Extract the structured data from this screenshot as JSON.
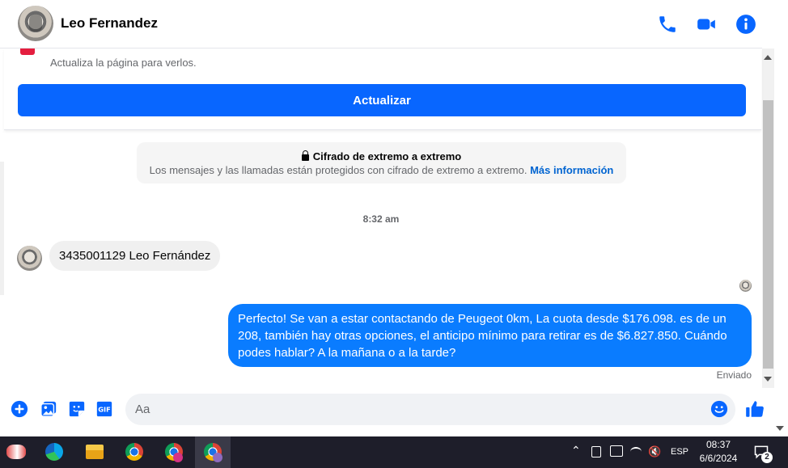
{
  "header": {
    "contact_name": "Leo Fernandez"
  },
  "banner": {
    "message": "Actualiza la página para verlos.",
    "refresh_label": "Actualizar"
  },
  "encryption": {
    "title": "Cifrado de extremo a extremo",
    "body": "Los mensajes y las llamadas están protegidos con cifrado de extremo a extremo.",
    "link": "Más información"
  },
  "conversation": {
    "timestamp": "8:32 am",
    "incoming": "3435001129 Leo Fernández",
    "outgoing": "Perfecto!  Se van a estar contactando de Peugeot 0km, La cuota desde $176.098. es de un 208, también hay otras opciones, el anticipo mínimo para retirar es de $6.827.850. Cuándo podes hablar? A la mañana o a la tarde?",
    "status": "Enviado"
  },
  "composer": {
    "placeholder": "Aa",
    "value": ""
  },
  "taskbar": {
    "language": "ESP",
    "time": "08:37",
    "date": "6/6/2024",
    "notification_count": "2"
  },
  "colors": {
    "accent": "#0866ff",
    "outgoing_bubble": "#0a7cff",
    "incoming_bubble": "#f0f0f0",
    "taskbar": "#1e1e2a"
  }
}
